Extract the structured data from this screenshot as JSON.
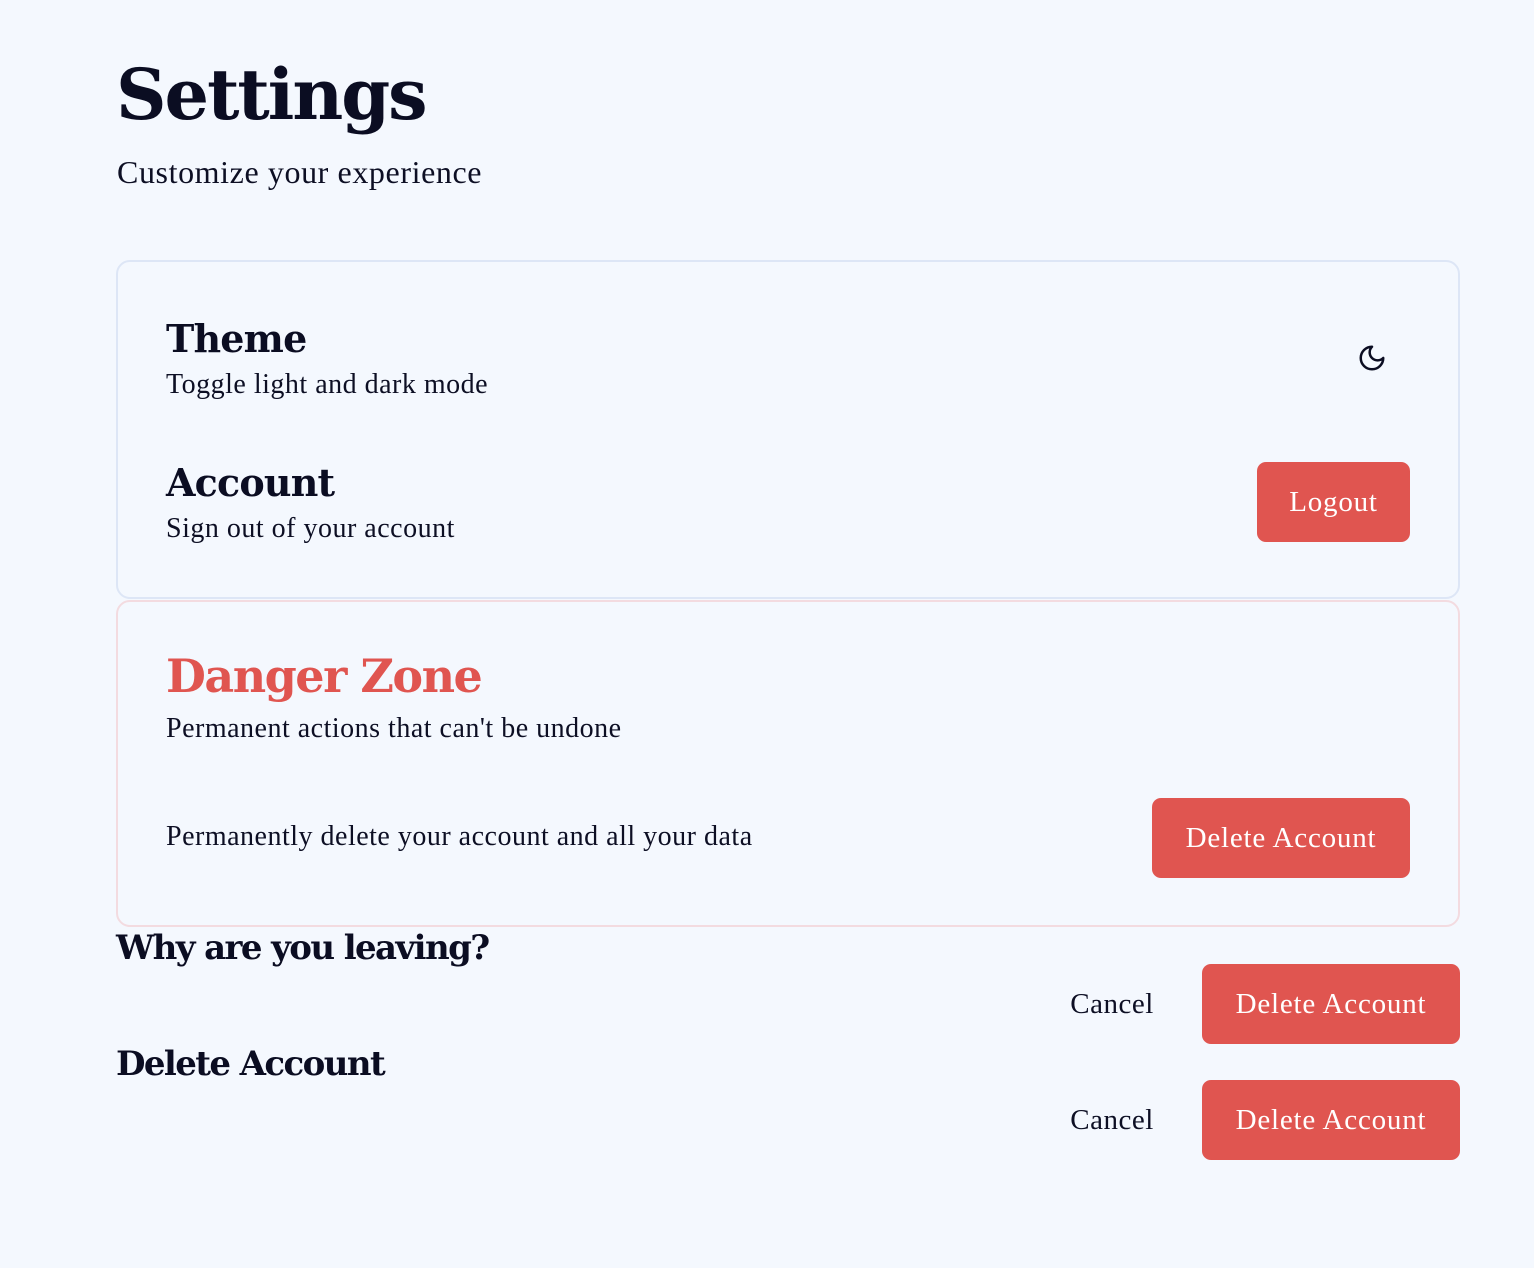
{
  "header": {
    "title": "Settings",
    "subtitle": "Customize your experience"
  },
  "settings_card": {
    "theme": {
      "title": "Theme",
      "description": "Toggle light and dark mode",
      "toggle_icon": "moon-icon"
    },
    "account": {
      "title": "Account",
      "description": "Sign out of your account",
      "logout_label": "Logout"
    }
  },
  "danger_zone": {
    "title": "Danger Zone",
    "subtitle": "Permanent actions that can't be undone",
    "delete_description": "Permanently delete your account and all your data",
    "delete_label": "Delete Account"
  },
  "leaving_dialog": {
    "heading": "Why are you leaving?",
    "cancel_label": "Cancel",
    "confirm_label": "Delete Account"
  },
  "delete_dialog": {
    "heading": "Delete Account",
    "cancel_label": "Cancel",
    "confirm_label": "Delete Account"
  },
  "colors": {
    "background": "#f4f8fe",
    "text": "#0b0d22",
    "danger": "#e05550",
    "card_border": "#dde6f6",
    "danger_border": "#f3dbe0"
  }
}
